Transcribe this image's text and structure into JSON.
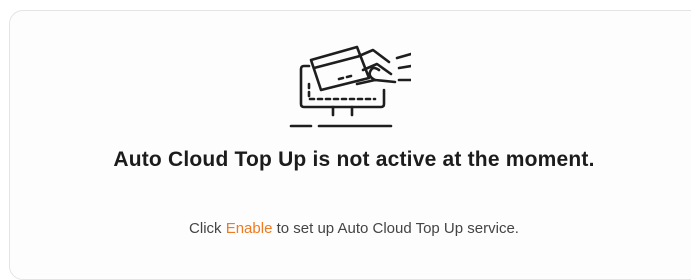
{
  "status": {
    "title": "Auto Cloud Top Up is not active at the moment.",
    "desc_prefix": "Click ",
    "enable_link": "Enable",
    "desc_suffix": " to set up Auto Cloud Top Up service."
  },
  "illustration": {
    "icon": "hand-inserting-card-into-monitor-icon"
  },
  "colors": {
    "accent": "#ee7a22",
    "title": "#1c1c1c",
    "text": "#444444",
    "line_art": "#1e1e1e",
    "card_border": "#e4e4e4"
  }
}
